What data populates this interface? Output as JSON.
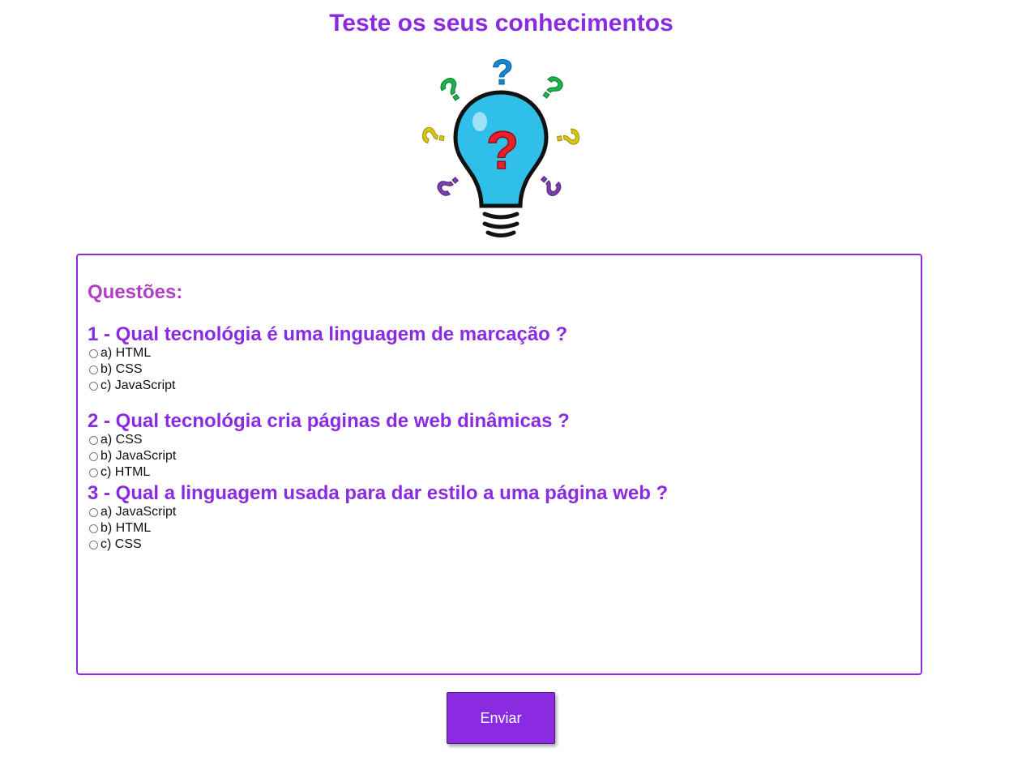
{
  "header": {
    "title": "Teste os seus conhecimentos"
  },
  "illustration": {
    "icon": "lightbulb-question-icon",
    "bulb_color": "#2fbfe8",
    "mark_color": "#e8202a"
  },
  "quiz": {
    "section_title": "Questões:",
    "questions": [
      {
        "text": "1 - Qual tecnológia é uma linguagem de marcação ?",
        "options": [
          "a) HTML",
          "b) CSS",
          "c) JavaScript"
        ]
      },
      {
        "text": "2 - Qual tecnológia cria páginas de web dinâmicas ?",
        "options": [
          "a) CSS",
          "b) JavaScript",
          "c) HTML"
        ]
      },
      {
        "text": "3 - Qual a linguagem usada para dar estilo a uma página web ?",
        "options": [
          "a) JavaScript",
          "b) HTML",
          "c) CSS"
        ]
      }
    ]
  },
  "actions": {
    "submit_label": "Enviar"
  },
  "colors": {
    "accent": "#8a2be2",
    "section_title": "#b03fc3"
  }
}
